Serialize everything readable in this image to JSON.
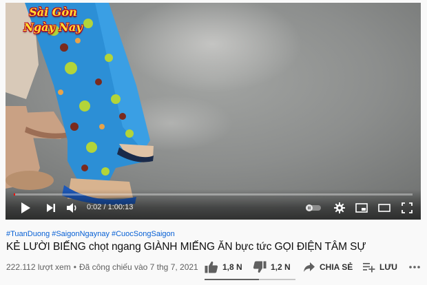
{
  "video": {
    "channel_logo": {
      "line1": "Sài Gòn",
      "line2": "Ngày Nay"
    },
    "time_current": "0:02",
    "time_separator": "/",
    "time_total": "1:00:13",
    "progress": 0.0006
  },
  "tags": [
    "#TuanDuong",
    "#SaigonNgaynay",
    "#CuocSongSaigon"
  ],
  "title": "KẺ LƯỜI BIẾNG chọt ngang GIÀNH MIẾNG ĂN bực tức GỌI ĐIỆN TÂM SỰ",
  "views": "222.112 lượt xem",
  "meta_separator": "•",
  "premiered": "Đã công chiếu vào 7 thg 7, 2021",
  "likes": "1,8 N",
  "dislikes": "1,2 N",
  "share_label": "CHIA SẺ",
  "save_label": "LƯU",
  "like_ratio": 0.6,
  "colors": {
    "accent": "#ff0000",
    "link": "#065fd4"
  }
}
